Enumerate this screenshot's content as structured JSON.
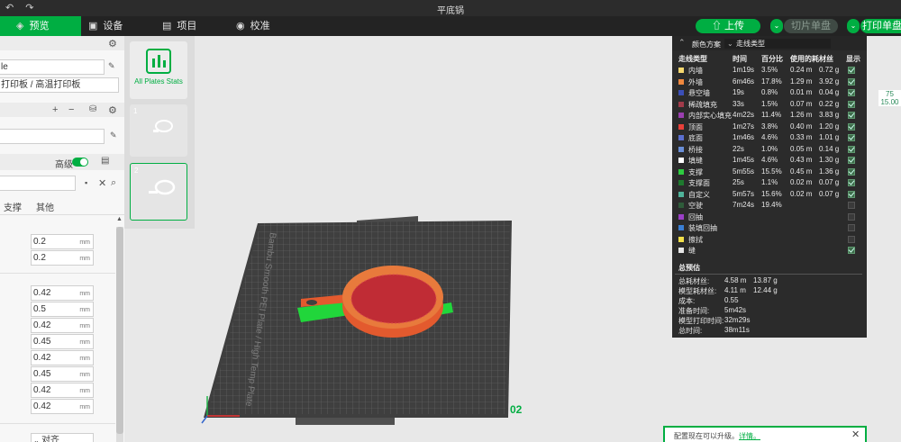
{
  "window": {
    "title": "平底锅"
  },
  "menubar": {
    "tabs": [
      {
        "label": "预览",
        "active": true
      },
      {
        "label": "设备"
      },
      {
        "label": "项目"
      },
      {
        "label": "校准"
      }
    ],
    "upload_label": "上传",
    "slice_label": "切片单盘",
    "print_label": "打印单盘"
  },
  "left_panel": {
    "filename_fragment": "le",
    "plate_type": "打印板 / 高温打印板",
    "advanced_label": "高级",
    "tabs": [
      "支撑",
      "其他"
    ],
    "field_values": [
      "0.2",
      "0.2",
      "0.42",
      "0.5",
      "0.42",
      "0.45",
      "0.42",
      "0.45",
      "0.42",
      "0.42"
    ],
    "unit": "mm",
    "bottom_label": "对齐"
  },
  "plates": {
    "stats_label": "All Plates Stats",
    "plate_numbers": [
      "1",
      "2"
    ]
  },
  "bed": {
    "label": "Bambu Smooth PEI Plate / High Temp Plate",
    "plate_id": "02"
  },
  "color_scheme": {
    "title": "颜色方案",
    "selected": "走线类型",
    "columns": [
      "走线类型",
      "时间",
      "百分比",
      "使用的耗材丝",
      "显示"
    ],
    "rows": [
      {
        "name": "内墙",
        "color": "#f5d76e",
        "time": "1m19s",
        "pct": "3.5%",
        "len": "0.24 m",
        "weight": "0.72 g",
        "shown": true
      },
      {
        "name": "外墙",
        "color": "#f0883e",
        "time": "6m46s",
        "pct": "17.8%",
        "len": "1.29 m",
        "weight": "3.92 g",
        "shown": true
      },
      {
        "name": "悬空墙",
        "color": "#3b4fb8",
        "time": "19s",
        "pct": "0.8%",
        "len": "0.01 m",
        "weight": "0.04 g",
        "shown": true
      },
      {
        "name": "稀疏填充",
        "color": "#a13b4a",
        "time": "33s",
        "pct": "1.5%",
        "len": "0.07 m",
        "weight": "0.22 g",
        "shown": true
      },
      {
        "name": "内部实心填充",
        "color": "#9a3fb0",
        "time": "4m22s",
        "pct": "11.4%",
        "len": "1.26 m",
        "weight": "3.83 g",
        "shown": true
      },
      {
        "name": "顶面",
        "color": "#e8403a",
        "time": "1m27s",
        "pct": "3.8%",
        "len": "0.40 m",
        "weight": "1.20 g",
        "shown": true
      },
      {
        "name": "底面",
        "color": "#5b6fd0",
        "time": "1m46s",
        "pct": "4.6%",
        "len": "0.33 m",
        "weight": "1.01 g",
        "shown": true
      },
      {
        "name": "桥接",
        "color": "#6a8fd8",
        "time": "22s",
        "pct": "1.0%",
        "len": "0.05 m",
        "weight": "0.14 g",
        "shown": true
      },
      {
        "name": "填缝",
        "color": "#ffffff",
        "time": "1m45s",
        "pct": "4.6%",
        "len": "0.43 m",
        "weight": "1.30 g",
        "shown": true
      },
      {
        "name": "支撑",
        "color": "#2ecc40",
        "time": "5m55s",
        "pct": "15.5%",
        "len": "0.45 m",
        "weight": "1.36 g",
        "shown": true
      },
      {
        "name": "支撑面",
        "color": "#1e7a2e",
        "time": "25s",
        "pct": "1.1%",
        "len": "0.02 m",
        "weight": "0.07 g",
        "shown": true
      },
      {
        "name": "自定义",
        "color": "#4fb39a",
        "time": "5m57s",
        "pct": "15.6%",
        "len": "0.02 m",
        "weight": "0.07 g",
        "shown": true
      },
      {
        "name": "空驶",
        "color": "#2e5c3a",
        "time": "7m24s",
        "pct": "19.4%",
        "len": "",
        "weight": "",
        "shown": false
      },
      {
        "name": "回抽",
        "color": "#9b3fc6",
        "time": "",
        "pct": "",
        "len": "",
        "weight": "",
        "shown": false
      },
      {
        "name": "装填回抽",
        "color": "#3a7fd4",
        "time": "",
        "pct": "",
        "len": "",
        "weight": "",
        "shown": false
      },
      {
        "name": "擦拭",
        "color": "#f2e04a",
        "time": "",
        "pct": "",
        "len": "",
        "weight": "",
        "shown": false
      },
      {
        "name": "缝",
        "color": "#e6e6e6",
        "time": "",
        "pct": "",
        "len": "",
        "weight": "",
        "shown": true
      }
    ],
    "summary_title": "总预估",
    "summary": [
      {
        "label": "总耗材丝:",
        "a": "4.58 m",
        "b": "13.87 g"
      },
      {
        "label": "模型耗材丝:",
        "a": "4.11 m",
        "b": "12.44 g"
      },
      {
        "label": "成本:",
        "a": "0.55",
        "b": ""
      },
      {
        "label": "准备时间:",
        "a": "5m42s",
        "b": ""
      },
      {
        "label": "模型打印时间:",
        "a": "32m29s",
        "b": ""
      },
      {
        "label": "总时间:",
        "a": "38m11s",
        "b": ""
      }
    ]
  },
  "layer_indicator": {
    "top": "75",
    "height": "15.00"
  },
  "notification": {
    "message": "配置现在可以升级。",
    "link": "详情。"
  }
}
